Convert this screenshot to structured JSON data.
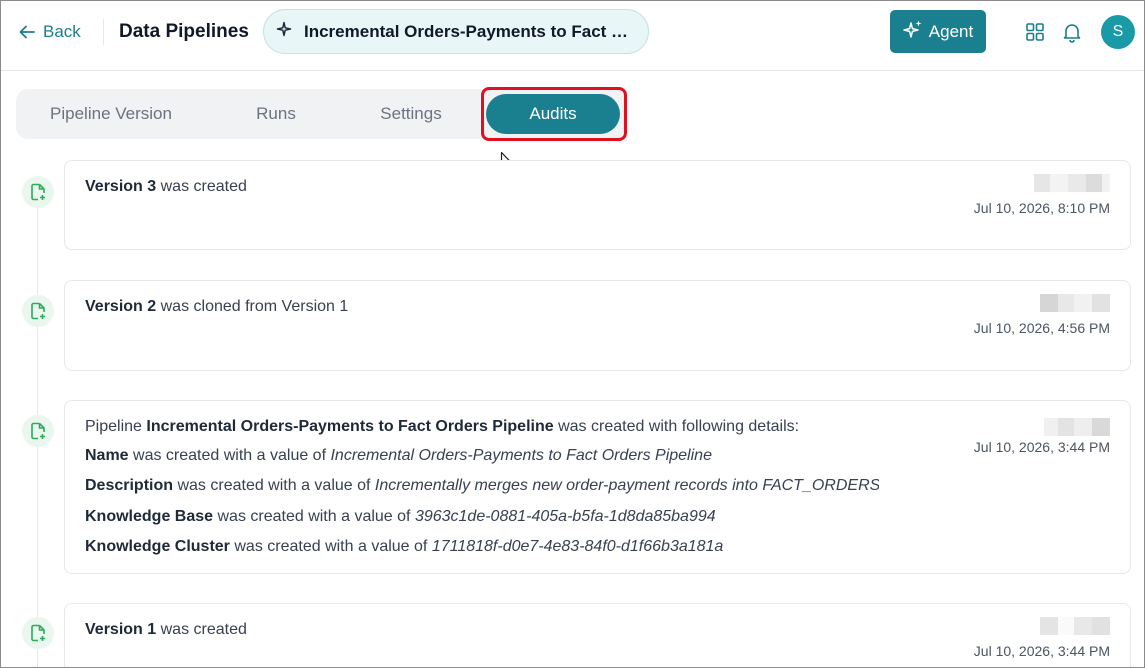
{
  "header": {
    "back_label": "Back",
    "title": "Data Pipelines",
    "pipeline_name": "Incremental Orders-Payments to Fact O…",
    "agent_label": "Agent",
    "avatar_initial": "S"
  },
  "tabs": [
    {
      "label": "Pipeline Version",
      "active": false
    },
    {
      "label": "Runs",
      "active": false
    },
    {
      "label": "Settings",
      "active": false
    },
    {
      "label": "Audits",
      "active": true
    }
  ],
  "audits": [
    {
      "subject": "Version 3",
      "text": "was created",
      "time": "Jul 10, 2026, 8:10 PM"
    },
    {
      "subject": "Version 2",
      "text": "was cloned from Version 1",
      "time": "Jul 10, 2026, 4:56 PM"
    },
    {
      "prefix": "Pipeline",
      "subject": "Incremental Orders-Payments to Fact Orders Pipeline",
      "text": "was created with following details:",
      "time": "Jul 10, 2026, 3:44 PM",
      "details": [
        {
          "field": "Name",
          "verb": "was created with a value of",
          "value": "Incremental Orders-Payments to Fact Orders Pipeline"
        },
        {
          "field": "Description",
          "verb": "was created with a value of",
          "value": "Incrementally merges new order-payment records into FACT_ORDERS"
        },
        {
          "field": "Knowledge Base",
          "verb": "was created with a value of",
          "value": "3963c1de-0881-405a-b5fa-1d8da85ba994"
        },
        {
          "field": "Knowledge Cluster",
          "verb": "was created with a value of",
          "value": "1711818f-d0e7-4e83-84f0-d1f66b3a181a"
        }
      ]
    },
    {
      "subject": "Version 1",
      "text": "was created",
      "time": "Jul 10, 2026, 3:44 PM"
    }
  ],
  "colors": {
    "accent": "#1a7f8e",
    "icon_green": "#2eaa5c",
    "highlight_red": "#e01020"
  },
  "icons": {
    "back": "arrow-left-icon",
    "pill": "sparkle-icon",
    "agent": "sparkles-icon",
    "apps": "grid-icon",
    "notifications": "bell-icon",
    "timeline": "file-plus-icon"
  }
}
